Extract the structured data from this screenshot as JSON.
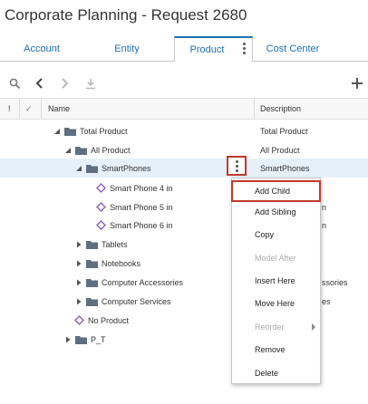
{
  "window": {
    "title": "Corporate Planning - Request 2680"
  },
  "tabs": [
    {
      "label": "Account"
    },
    {
      "label": "Entity"
    },
    {
      "label": "Product"
    },
    {
      "label": "Cost Center"
    }
  ],
  "active_tab": "Product",
  "grid": {
    "col_status": "!",
    "col_check": "✓",
    "col_name": "Name",
    "col_description": "Description"
  },
  "rows": [
    {
      "name": "Total Product",
      "description": "Total Product"
    },
    {
      "name": "All Product",
      "description": "All Product"
    },
    {
      "name": "SmartPhones",
      "description": "SmartPhones"
    },
    {
      "name": "Smart Phone 4 in",
      "description": ""
    },
    {
      "name": "Smart Phone 5 in",
      "description": "n"
    },
    {
      "name": "Smart Phone 6 in",
      "description": "n"
    },
    {
      "name": "Tablets",
      "description": ""
    },
    {
      "name": "Notebooks",
      "description": ""
    },
    {
      "name": "Computer Accessories",
      "description": "ssories"
    },
    {
      "name": "Computer Services",
      "description": "es"
    },
    {
      "name": "No Product",
      "description": ""
    },
    {
      "name": "P_T",
      "description": ""
    }
  ],
  "context_menu": {
    "items": [
      {
        "label": "Add Child",
        "enabled": true
      },
      {
        "label": "Add Sibling",
        "enabled": true
      },
      {
        "label": "Copy",
        "enabled": true
      },
      {
        "label": "Model After",
        "enabled": false
      },
      {
        "label": "Insert Here",
        "enabled": true
      },
      {
        "label": "Move Here",
        "enabled": true
      },
      {
        "label": "Reorder",
        "enabled": false
      },
      {
        "label": "Remove",
        "enabled": true
      },
      {
        "label": "Delete",
        "enabled": true
      }
    ]
  },
  "colors": {
    "accent": "#1f6fb2",
    "highlight_border": "#c0392b",
    "folder": "#5f6f82",
    "member_icon": "#8b5fbf",
    "selected_row": "#e6f0f8"
  },
  "icons": {
    "toolbar": [
      "search-icon",
      "back-icon",
      "forward-icon",
      "download-icon",
      "add-icon"
    ],
    "tree": [
      "folder-icon",
      "member-icon",
      "expand-arrow-icon"
    ]
  }
}
